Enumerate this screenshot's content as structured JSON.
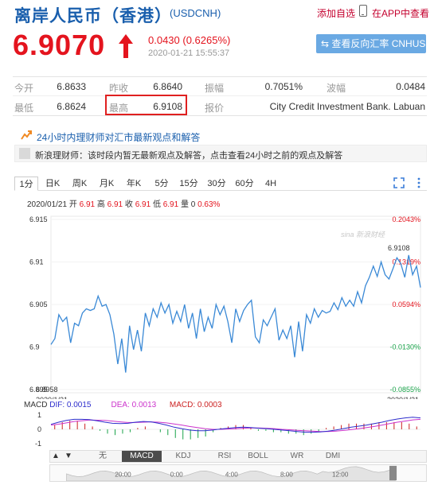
{
  "header": {
    "title": "离岸人民币（香港）",
    "code": "(USDCNH)",
    "add_watchlist": "添加自选",
    "view_in_app": "在APP中查看"
  },
  "quote": {
    "price": "6.9070",
    "change": "0.0430 (0.6265%)",
    "timestamp": "2020-01-21 15:55:37",
    "reverse_button": "查看反向汇率 CNHUSD",
    "color_up": "#e4141e"
  },
  "table": {
    "open_label": "今开",
    "open": "6.8633",
    "prev_close_label": "昨收",
    "prev_close": "6.8640",
    "amplitude_label": "振幅",
    "amplitude": "0.7051%",
    "wave_label": "波幅",
    "wave": "0.0484",
    "low_label": "最低",
    "low": "6.8624",
    "high_label": "最高",
    "high": "6.9108",
    "quote_label": "报价",
    "quote_source": "City Credit Investment Bank. Labuan"
  },
  "analysis": {
    "title": "24小时内理财师对汇市最新观点和解答",
    "message": "新浪理财师：该时段内暂无最新观点及解答，点击查看24小时之前的观点及解答"
  },
  "tabs": [
    "1分",
    "日K",
    "周K",
    "月K",
    "年K",
    "5分",
    "15分",
    "30分",
    "60分",
    "4H"
  ],
  "active_tab": "1分",
  "bar_info": {
    "date": "2020/01/21",
    "open_label": "开",
    "open": "6.91",
    "high_label": "高",
    "high": "6.91",
    "close_label": "收",
    "close": "6.91",
    "low_label": "低",
    "low": "6.91",
    "volume_label": "量",
    "volume": "0",
    "pct": "0.63%"
  },
  "chart_data": {
    "type": "line",
    "title": "",
    "y_ticks": [
      "6.915",
      "6.91",
      "6.905",
      "6.9",
      "6.895"
    ],
    "pct_ticks": [
      "0.2043%",
      "0.1319%",
      "0.0594%",
      "-0.0130%",
      "-0.0855%"
    ],
    "ylim": [
      6.895,
      6.915
    ],
    "max_label": "6.9108",
    "min_label": "6.8958",
    "x_start_label": "2020/1/21",
    "x_end_label": "2020/1/21",
    "watermark": "sina 新浪财经",
    "series": [
      {
        "values": [
          6.9003,
          6.901,
          6.9038,
          6.903,
          6.9035,
          6.9005,
          6.9028,
          6.9025,
          6.904,
          6.9045,
          6.9043,
          6.9045,
          6.906,
          6.9048,
          6.905,
          6.9038,
          6.9015,
          6.898,
          6.901,
          6.897,
          6.9025,
          6.8997,
          6.902,
          6.8995,
          6.904,
          6.9025,
          6.9045,
          6.9035,
          6.9052,
          6.904,
          6.905,
          6.9028,
          6.9042,
          6.903,
          6.905,
          6.9022,
          6.904,
          6.901,
          6.9045,
          6.9018,
          6.9035,
          6.9022,
          6.905,
          6.9038,
          6.9048,
          6.903,
          6.9005,
          6.9045,
          6.903,
          6.9043,
          6.905,
          6.9055,
          6.9012,
          6.9005,
          6.9032,
          6.9025,
          6.9035,
          6.9045,
          6.9008,
          6.902,
          6.901,
          6.9025,
          6.8988,
          6.903,
          6.8995,
          6.9038,
          6.9028,
          6.9045,
          6.9035,
          6.9043,
          6.904,
          6.9042,
          6.9052,
          6.9044,
          6.9058,
          6.9048,
          6.9055,
          6.9048,
          6.9065,
          6.9052,
          6.9072,
          6.9082,
          6.9095,
          6.9083,
          6.91,
          6.9085,
          6.908,
          6.9092,
          6.9105,
          6.9098,
          6.9082,
          6.9108,
          6.9085,
          6.9095,
          6.907
        ]
      }
    ]
  },
  "macd": {
    "label": "MACD",
    "dif_label": "DIF",
    "dif": "0.0015",
    "dea_label": "DEA",
    "dea": "0.0013",
    "macd_label": "MACD",
    "macd": "0.0003",
    "y_ticks": [
      "1",
      "0",
      "-1"
    ],
    "dif_values": [
      0.35,
      0.5,
      0.62,
      0.7,
      0.7,
      0.68,
      0.6,
      0.5,
      0.42,
      0.4,
      0.42,
      0.5,
      0.55,
      0.52,
      0.42,
      0.3,
      0.15,
      0.05,
      -0.05,
      -0.1,
      -0.1,
      -0.05,
      0.02,
      0.08,
      0.12,
      0.15,
      0.12,
      0.08,
      0.05,
      0.0,
      -0.05,
      -0.1,
      -0.15,
      -0.2,
      -0.2,
      -0.18,
      -0.12,
      -0.05,
      0.05,
      0.15,
      0.22,
      0.3,
      0.4,
      0.5,
      0.62,
      0.72,
      0.8,
      0.85,
      0.8
    ],
    "dea_values": [
      0.3,
      0.36,
      0.45,
      0.55,
      0.6,
      0.65,
      0.64,
      0.62,
      0.58,
      0.52,
      0.48,
      0.48,
      0.5,
      0.52,
      0.5,
      0.45,
      0.38,
      0.3,
      0.2,
      0.12,
      0.05,
      0.0,
      0.0,
      0.02,
      0.05,
      0.08,
      0.1,
      0.1,
      0.08,
      0.05,
      0.0,
      -0.03,
      -0.07,
      -0.1,
      -0.13,
      -0.15,
      -0.15,
      -0.12,
      -0.08,
      -0.02,
      0.05,
      0.12,
      0.2,
      0.3,
      0.4,
      0.5,
      0.58,
      0.66,
      0.7
    ],
    "hist_values": [
      0.3,
      0.5,
      0.6,
      0.6,
      0.4,
      0.2,
      -0.1,
      -0.3,
      -0.4,
      -0.3,
      -0.2,
      0.1,
      0.2,
      0.0,
      -0.2,
      -0.4,
      -0.6,
      -0.7,
      -0.7,
      -0.6,
      -0.5,
      -0.2,
      0.1,
      0.2,
      0.3,
      0.3,
      0.1,
      -0.1,
      -0.1,
      -0.2,
      -0.2,
      -0.3,
      -0.3,
      -0.4,
      -0.3,
      -0.2,
      0.1,
      0.2,
      0.3,
      0.4,
      0.4,
      0.4,
      0.4,
      0.5,
      0.5,
      0.5,
      0.5,
      0.4,
      0.2
    ],
    "dif_color": "#2d2dcc",
    "dea_color": "#cc33cc",
    "macd_color": "#cc2222"
  },
  "indicator_tabs": [
    "无",
    "MACD",
    "KDJ",
    "RSI",
    "BOLL",
    "WR",
    "DMI"
  ],
  "active_indicator": "MACD",
  "time_labels": [
    "20:00",
    "0:00",
    "4:00",
    "8:00",
    "12:00"
  ]
}
